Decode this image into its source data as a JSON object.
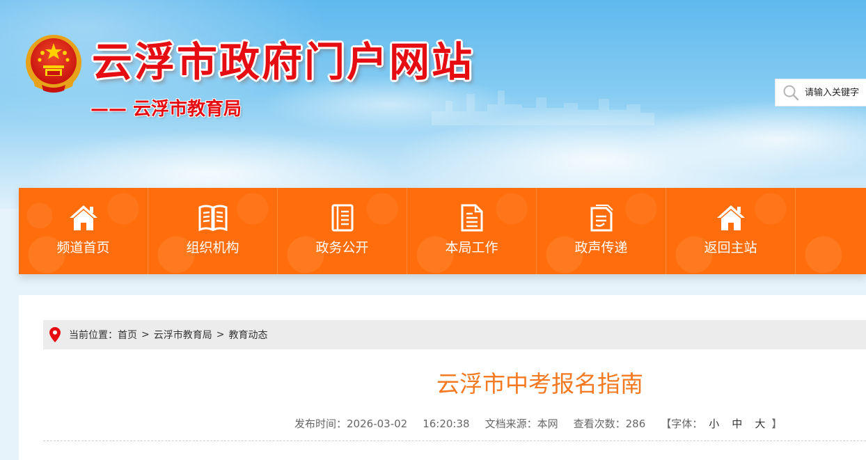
{
  "header": {
    "site_title": "云浮市政府门户网站",
    "sub_title": "—— 云浮市教育局",
    "search_placeholder": "请输入关键字"
  },
  "nav": {
    "items": [
      {
        "label": "频道首页",
        "icon": "home-icon"
      },
      {
        "label": "组织机构",
        "icon": "book-icon"
      },
      {
        "label": "政务公开",
        "icon": "notebook-icon"
      },
      {
        "label": "本局工作",
        "icon": "document-icon"
      },
      {
        "label": "政声传递",
        "icon": "file-icon"
      },
      {
        "label": "返回主站",
        "icon": "home-icon"
      }
    ]
  },
  "breadcrumb": {
    "prefix": "当前位置：",
    "items": [
      "首页",
      "云浮市教育局",
      "教育动态"
    ],
    "separator": ">"
  },
  "article": {
    "title": "云浮市中考报名指南",
    "publish_label": "发布时间：",
    "publish_date": "2026-03-02",
    "publish_time": "16:20:38",
    "source_label": "文档来源：",
    "source": "本网",
    "views_label": "查看次数：",
    "views": "286",
    "font_label": "【字体：",
    "font_small": "小",
    "font_medium": "中",
    "font_large": "大",
    "font_close": "】"
  },
  "colors": {
    "nav_bg": "#ff6d0c",
    "title_red": "#e60d12",
    "article_title": "#f47920"
  }
}
